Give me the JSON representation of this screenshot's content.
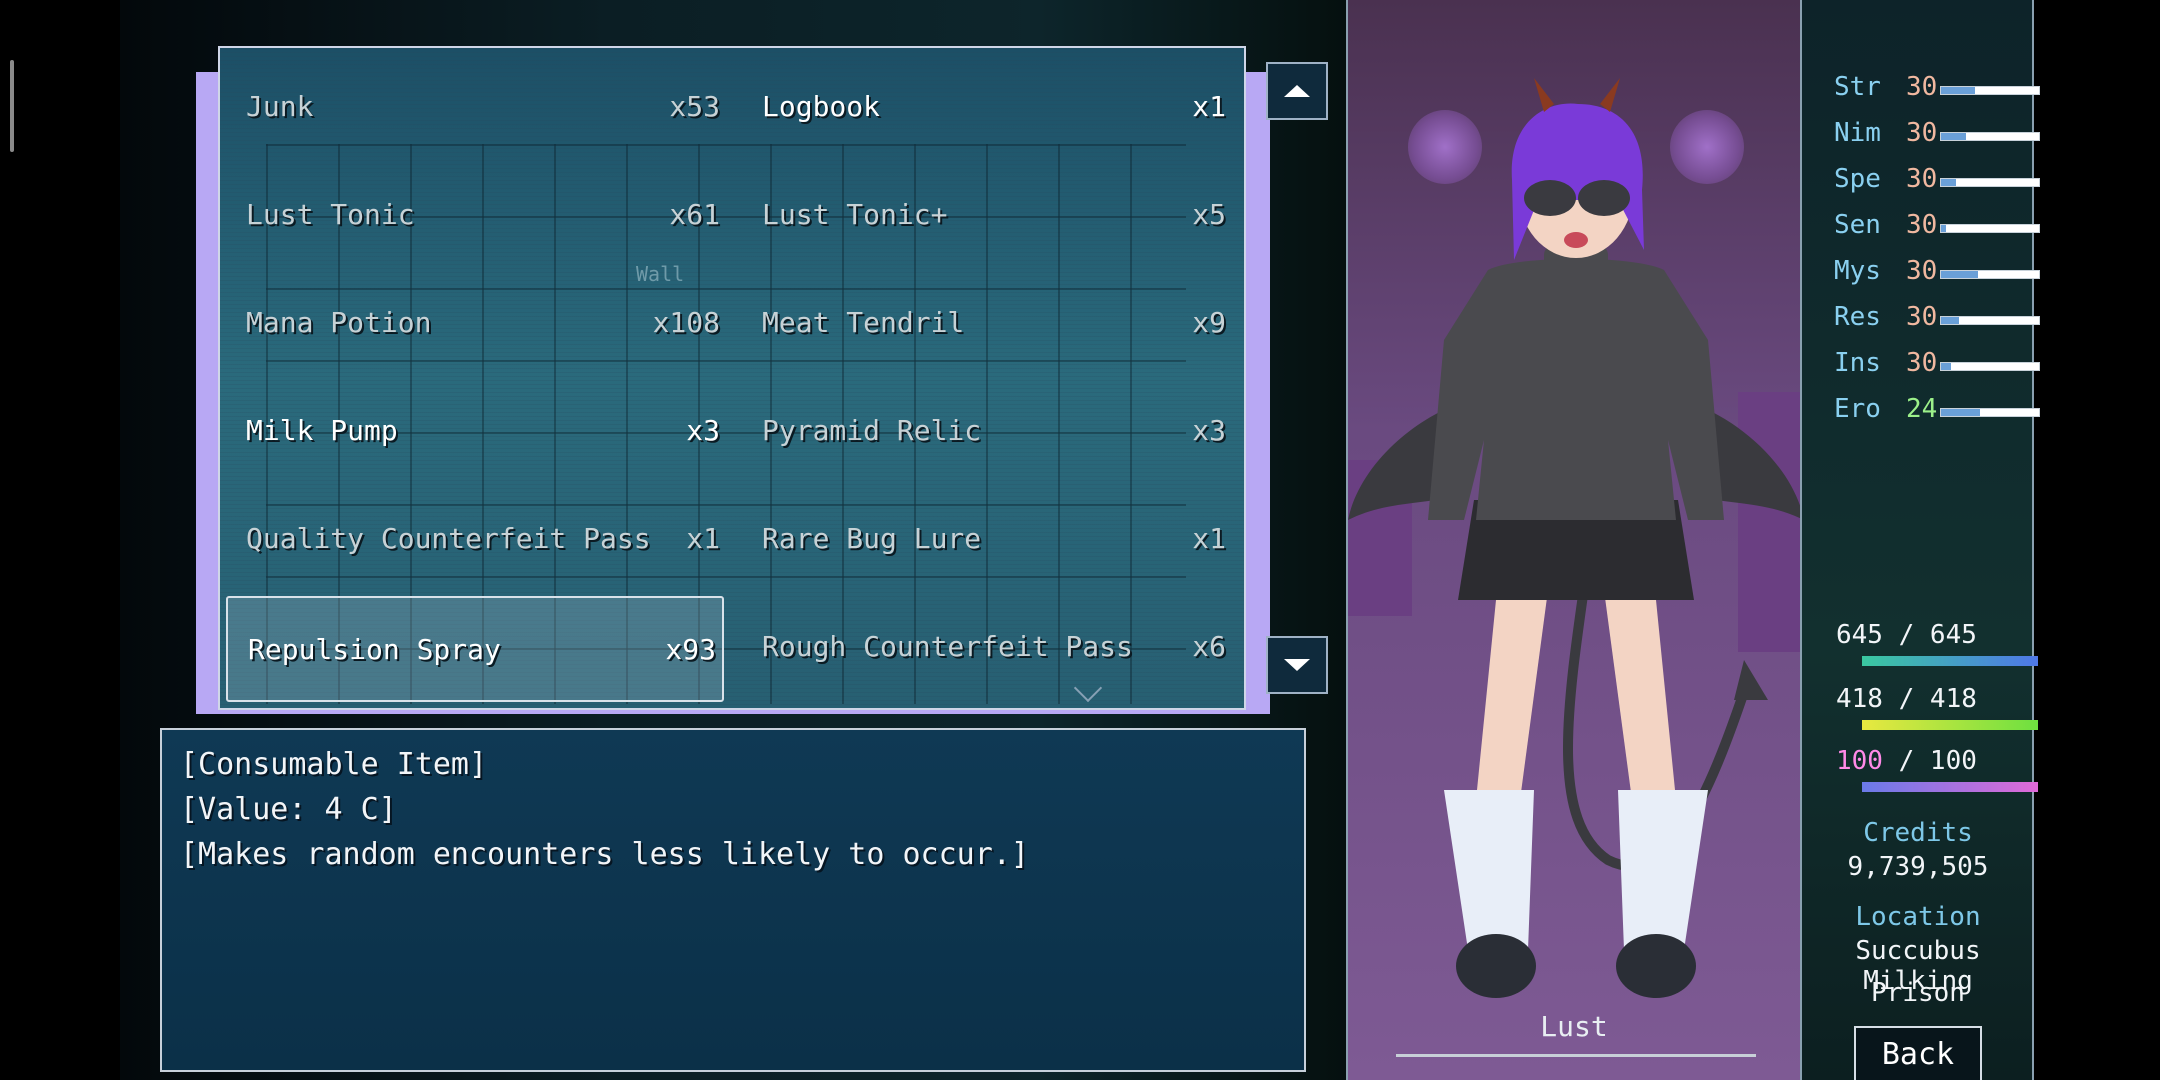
{
  "inventory": {
    "items": [
      {
        "name": "Junk",
        "qty": "x53"
      },
      {
        "name": "Logbook",
        "qty": "x1"
      },
      {
        "name": "Lust Tonic",
        "qty": "x61"
      },
      {
        "name": "Lust Tonic+",
        "qty": "x5"
      },
      {
        "name": "Mana Potion",
        "qty": "x108"
      },
      {
        "name": "Meat Tendril",
        "qty": "x9"
      },
      {
        "name": "Milk Pump",
        "qty": "x3"
      },
      {
        "name": "Pyramid Relic",
        "qty": "x3"
      },
      {
        "name": "Quality Counterfeit Pass",
        "qty": "x1"
      },
      {
        "name": "Rare Bug Lure",
        "qty": "x1"
      },
      {
        "name": "Repulsion Spray",
        "qty": "x93"
      },
      {
        "name": "Rough Counterfeit Pass",
        "qty": "x6"
      }
    ],
    "selected": "Repulsion Spray",
    "map_wall_label": "Wall"
  },
  "description": {
    "line1": "[Consumable Item]",
    "line2": "[Value: 4 C]",
    "line3": "[Makes random encounters less likely to occur.]"
  },
  "portrait": {
    "label": "Lust"
  },
  "stats": [
    {
      "label": "Str",
      "value": "30",
      "level": 0.35
    },
    {
      "label": "Nim",
      "value": "30",
      "level": 0.25
    },
    {
      "label": "Spe",
      "value": "30",
      "level": 0.15
    },
    {
      "label": "Sen",
      "value": "30",
      "level": 0.05
    },
    {
      "label": "Mys",
      "value": "30",
      "level": 0.38
    },
    {
      "label": "Res",
      "value": "30",
      "level": 0.18
    },
    {
      "label": "Ins",
      "value": "30",
      "level": 0.1
    },
    {
      "label": "Ero",
      "value": "24",
      "level": 0.4
    }
  ],
  "gauges": {
    "hp": {
      "text": "645 / 645",
      "level": 1.0,
      "color": "#4f78e8"
    },
    "mp": {
      "text": "418 / 418",
      "level": 1.0,
      "color": "#6ee040"
    },
    "lust": {
      "current": "100",
      "rest": " / 100",
      "level": 1.0,
      "color": "#e06ad8"
    }
  },
  "credits": {
    "label": "Credits",
    "value": "9,739,505"
  },
  "location": {
    "label": "Location",
    "line1": "Succubus Milking",
    "line2": "Prison"
  },
  "back_label": "Back",
  "colors": {
    "stat_label": "#8ad0f0",
    "stat_value": "#f0b8a0",
    "ero_value": "#9cf08a",
    "panel_accent": "#b8a8f4"
  }
}
